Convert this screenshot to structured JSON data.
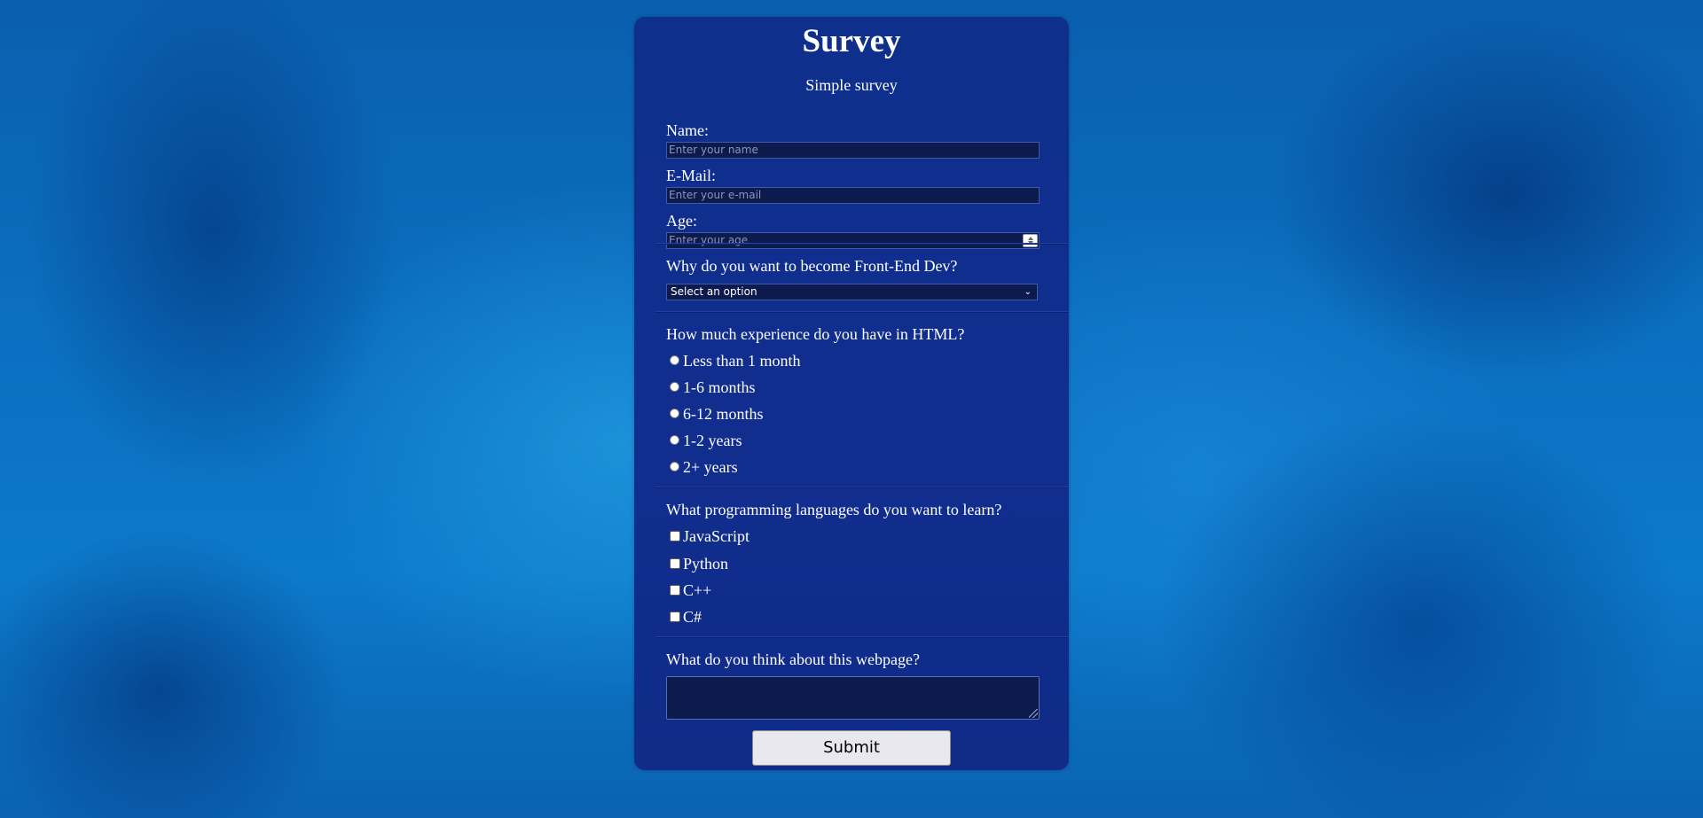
{
  "header": {
    "title": "Survey",
    "subtitle": "Simple survey"
  },
  "fields": {
    "name": {
      "label": "Name:",
      "placeholder": "Enter your name",
      "value": ""
    },
    "email": {
      "label": "E-Mail:",
      "placeholder": "Enter your e-mail",
      "value": ""
    },
    "age": {
      "label": "Age:",
      "placeholder": "Enter your age",
      "value": ""
    }
  },
  "questions": {
    "why_frontend": {
      "question": "Why do you want to become Front-End Dev?",
      "selected": "Select an option"
    },
    "html_experience": {
      "question": "How much experience do you have in HTML?",
      "options": [
        "Less than 1 month",
        "1-6 months",
        "6-12 months",
        "1-2 years",
        "2+ years"
      ]
    },
    "languages": {
      "question": "What programming languages do you want to learn?",
      "options": [
        "JavaScript",
        "Python",
        "C++",
        "C#"
      ]
    },
    "feedback": {
      "question": "What do you think about this webpage?",
      "value": ""
    }
  },
  "submit": {
    "label": "Submit"
  },
  "colors": {
    "card": "#102e8c",
    "input_bg": "#0c1a4e",
    "text": "#ffffff",
    "button_bg": "#e9e8ee"
  }
}
